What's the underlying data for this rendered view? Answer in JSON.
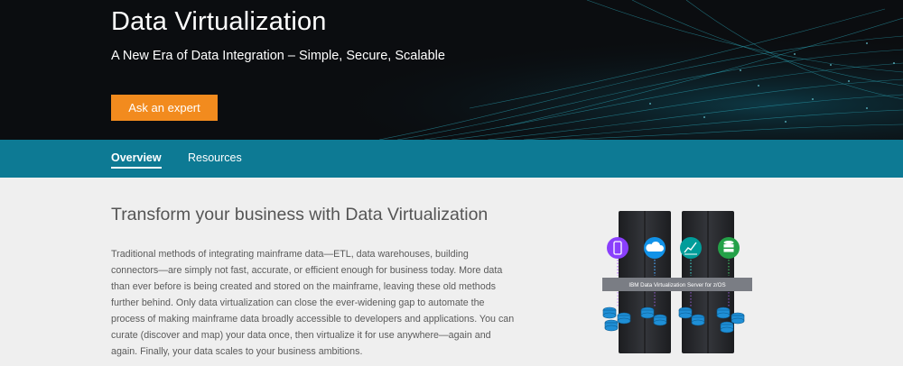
{
  "hero": {
    "title": "Data Virtualization",
    "subtitle": "A New Era of Data Integration – Simple, Secure, Scalable",
    "cta_label": "Ask an expert"
  },
  "tabs": [
    {
      "label": "Overview",
      "active": true
    },
    {
      "label": "Resources",
      "active": false
    }
  ],
  "content": {
    "heading": "Transform your business with Data Virtualization",
    "body": "Traditional methods of integrating mainframe data—ETL, data warehouses, building connectors—are simply not fast, accurate, or efficient enough for business today. More data than ever before is being created and stored on the mainframe, leaving these old methods further behind. Only data virtualization can close the ever-widening gap to automate the process of making mainframe data broadly accessible to developers and applications. You can curate (discover and map) your data once, then virtualize it for use anywhere—again and again. Finally, your data scales to your business ambitions."
  },
  "illustration": {
    "server_label": "IBM Data Virtualization Server for z/OS",
    "icons": [
      "mobile-icon",
      "cloud-icon",
      "analytics-icon",
      "database-icon"
    ],
    "icon_colors": [
      "#8a3ffc",
      "#1192e8",
      "#009d9a",
      "#24a148"
    ]
  },
  "colors": {
    "accent": "#f28b1e",
    "tabbar": "#0d7a94",
    "hero_bg": "#0b0d10"
  }
}
